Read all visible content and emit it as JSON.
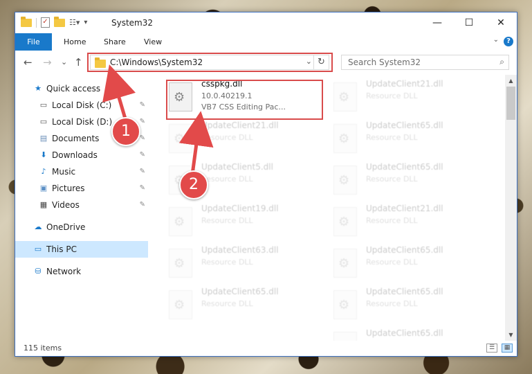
{
  "window": {
    "title": "System32"
  },
  "ribbon": {
    "file": "File",
    "tabs": [
      "Home",
      "Share",
      "View"
    ],
    "help": "?"
  },
  "nav": {
    "back": "←",
    "forward": "→",
    "recent": "⌄",
    "up": "↑"
  },
  "address": {
    "path": "C:\\Windows\\System32",
    "dropdown": "⌄",
    "refresh": "↻"
  },
  "search": {
    "placeholder": "Search System32",
    "icon": "⌕"
  },
  "sidebar": {
    "items": [
      {
        "label": "Quick access",
        "icon": "★",
        "icon_color": "#1979ca",
        "pinned": false
      },
      {
        "label": "Local Disk (C:)",
        "icon": "▭",
        "icon_color": "#555555",
        "pinned": true
      },
      {
        "label": "Local Disk (D:)",
        "icon": "▭",
        "icon_color": "#555555",
        "pinned": true
      },
      {
        "label": "Documents",
        "icon": "▤",
        "icon_color": "#6b8fb8",
        "pinned": true
      },
      {
        "label": "Downloads",
        "icon": "⬇",
        "icon_color": "#1979ca",
        "pinned": true
      },
      {
        "label": "Music",
        "icon": "♪",
        "icon_color": "#1979ca",
        "pinned": true
      },
      {
        "label": "Pictures",
        "icon": "▣",
        "icon_color": "#5b8fc5",
        "pinned": true
      },
      {
        "label": "Videos",
        "icon": "▦",
        "icon_color": "#444444",
        "pinned": true
      },
      {
        "label": "OneDrive",
        "icon": "☁",
        "icon_color": "#1979ca",
        "pinned": false
      },
      {
        "label": "This PC",
        "icon": "▭",
        "icon_color": "#1979ca",
        "pinned": false
      },
      {
        "label": "Network",
        "icon": "⛁",
        "icon_color": "#1979ca",
        "pinned": false
      }
    ],
    "pin_glyph": "📌"
  },
  "files": {
    "highlighted": {
      "name": "csspkg.dll",
      "version": "10.0.40219.1",
      "description": "VB7 CSS Editing Pac..."
    },
    "others": [
      {
        "name": "UpdateClient21.dll",
        "type": "Resource DLL"
      },
      {
        "name": "UpdateClient21.dll",
        "type": "Resource DLL"
      },
      {
        "name": "UpdateClient65.dll",
        "type": "Resource DLL"
      },
      {
        "name": "UpdateClient5.dll",
        "type": "Resource DLL"
      },
      {
        "name": "UpdateClient65.dll",
        "type": "Resource DLL"
      },
      {
        "name": "UpdateClient19.dll",
        "type": "Resource DLL"
      },
      {
        "name": "UpdateClient21.dll",
        "type": "Resource DLL"
      },
      {
        "name": "UpdateClient63.dll",
        "type": "Resource DLL"
      },
      {
        "name": "UpdateClient65.dll",
        "type": "Resource DLL"
      },
      {
        "name": "UpdateClient65.dll",
        "type": "Resource DLL"
      },
      {
        "name": "UpdateClient65.dll",
        "type": "Resource DLL"
      },
      {
        "name": "UpdateClient65.dll",
        "type": "Resource DLL"
      }
    ]
  },
  "status": {
    "items": "115 items"
  },
  "annotations": {
    "step1": "1",
    "step2": "2",
    "color": "#e24a4a"
  },
  "window_buttons": {
    "minimize": "—",
    "maximize": "☐",
    "close": "✕"
  }
}
